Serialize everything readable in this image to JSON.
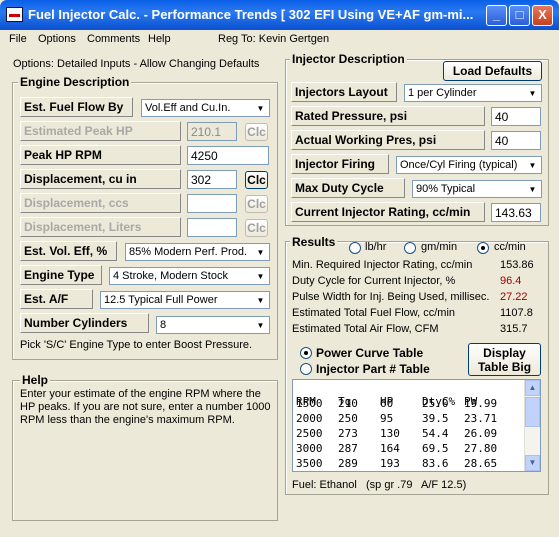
{
  "window": {
    "title": "Fuel Injector Calc. - Performance Trends  [ 302 EFI Using VE+AF gm-mi...",
    "icon": "app-icon",
    "controls": {
      "minimize": "_",
      "maximize": "□",
      "close": "X"
    }
  },
  "menu": {
    "items": [
      "File",
      "Options",
      "Comments",
      "Help"
    ],
    "reg": "Reg To: Kevin Gertgen"
  },
  "options_text": "Options: Detailed Inputs - Allow Changing Defaults",
  "engine": {
    "title": "Engine Description",
    "fuel_flow_by_label": "Est. Fuel Flow By",
    "fuel_flow_by_value": "Vol.Eff and Cu.In.",
    "est_peak_hp_label": "Estimated Peak HP",
    "est_peak_hp_value": "210.1",
    "clc": "Clc",
    "peak_hp_rpm_label": "Peak HP RPM",
    "peak_hp_rpm_value": "4250",
    "disp_cuin_label": "Displacement, cu in",
    "disp_cuin_value": "302",
    "disp_ccs_label": "Displacement, ccs",
    "disp_ccs_value": "",
    "disp_liters_label": "Displacement, Liters",
    "disp_liters_value": "",
    "vol_eff_label": "Est. Vol. Eff, %",
    "vol_eff_value": "85% Modern Perf. Prod.",
    "engine_type_label": "Engine Type",
    "engine_type_value": "4 Stroke, Modern Stock",
    "af_label": "Est. A/F",
    "af_value": "12.5 Typical Full Power",
    "cyl_label": "Number Cylinders",
    "cyl_value": "8",
    "note": "Pick 'S/C' Engine Type to enter Boost Pressure."
  },
  "help": {
    "title": "Help",
    "text": "Enter your estimate of the engine RPM where the HP peaks.  If you are not sure, enter a number 1000 RPM less than the engine's maximum RPM."
  },
  "injector": {
    "title": "Injector Description",
    "load_defaults": "Load Defaults",
    "layout_label": "Injectors Layout",
    "layout_value": "1 per Cylinder",
    "rated_label": "Rated Pressure, psi",
    "rated_value": "40",
    "actual_label": "Actual Working Pres, psi",
    "actual_value": "40",
    "firing_label": "Injector Firing",
    "firing_value": "Once/Cyl Firing (typical)",
    "duty_label": "Max Duty Cycle",
    "duty_value": "90% Typical",
    "rating_label": "Current Injector Rating, cc/min",
    "rating_value": "143.63"
  },
  "results": {
    "title": "Results",
    "units": [
      "lb/hr",
      "gm/min",
      "cc/min"
    ],
    "selected_unit": "cc/min",
    "rows": [
      {
        "label": "Min. Required Injector Rating, cc/min",
        "value": "153.86",
        "color": "#000000"
      },
      {
        "label": "Duty Cycle for Current Injector, %",
        "value": "96.4",
        "color": "#a00000"
      },
      {
        "label": "Pulse Width for Inj. Being Used, millisec.",
        "value": "27.22",
        "color": "#a00000"
      },
      {
        "label": "Estimated Total Fuel Flow, cc/min",
        "value": "1107.8",
        "color": "#000000"
      },
      {
        "label": "Estimated Total Air Flow, CFM",
        "value": "315.7",
        "color": "#000000"
      }
    ],
    "power_curve": "Power Curve Table",
    "part_table": "Injector Part # Table",
    "display_big": "Display Table Big",
    "table_header": [
      "RPM",
      "Tq",
      "HP",
      "DtyC%",
      "PW"
    ],
    "table_rows": [
      [
        "1500",
        "210",
        "60",
        "25.0",
        "19.99"
      ],
      [
        "2000",
        "250",
        "95",
        "39.5",
        "23.71"
      ],
      [
        "2500",
        "273",
        "130",
        "54.4",
        "26.09"
      ],
      [
        "3000",
        "287",
        "164",
        "69.5",
        "27.80"
      ],
      [
        "3500",
        "289",
        "193",
        "83.6",
        "28.65"
      ]
    ],
    "fuel": "Fuel: Ethanol   (sp gr .79   A/F 12.5)"
  }
}
